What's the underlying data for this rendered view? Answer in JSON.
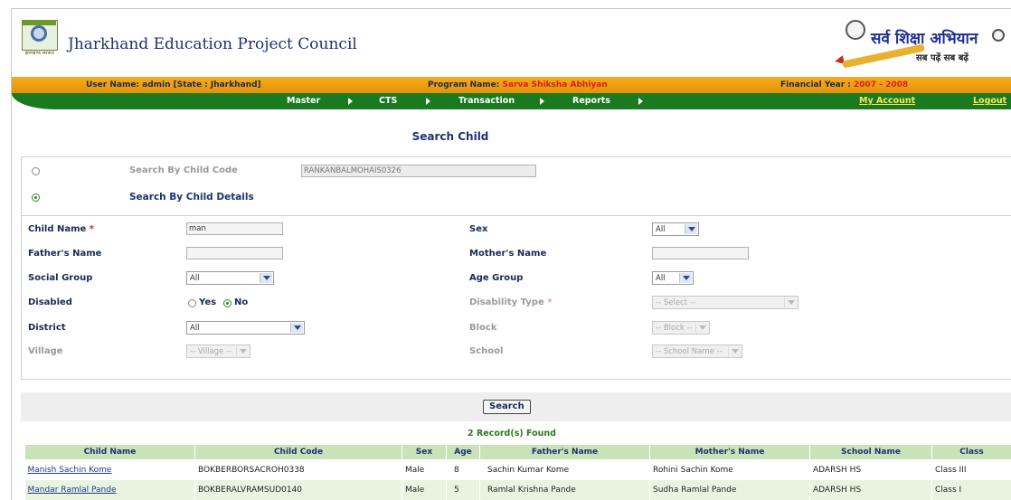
{
  "header": {
    "title": "Jharkhand Education Project Council",
    "logo_caption": "झारखण्ड सरकार",
    "ssa_logo_text": "सर्व शिक्षा अभियान",
    "ssa_logo_tagline": "सब पढ़ें सब बढ़ें"
  },
  "infobar": {
    "user_label": "User Name: admin [State : Jharkhand]",
    "program_label": "Program Name:",
    "program_value": "Sarva Shiksha Abhiyan",
    "fy_label": "Financial Year :",
    "fy_value": "2007 - 2008"
  },
  "nav": {
    "items": [
      "Master",
      "CTS",
      "Transaction",
      "Reports"
    ],
    "my_account": "My Account",
    "logout": "Logout"
  },
  "page": {
    "title": "Search Child"
  },
  "search_mode": {
    "by_code_label": "Search By Child Code",
    "by_code_value": "RANKANBALMOHAIS0326",
    "by_details_label": "Search By Child Details",
    "selected": "details"
  },
  "form": {
    "child_name_label": "Child Name",
    "required_mark": "*",
    "child_name_value": "man",
    "sex_label": "Sex",
    "sex_value": "All",
    "fathers_name_label": "Father's Name",
    "fathers_name_value": "",
    "mothers_name_label": "Mother's Name",
    "mothers_name_value": "",
    "social_group_label": "Social Group",
    "social_group_value": "All",
    "age_group_label": "Age Group",
    "age_group_value": "All",
    "disabled_label": "Disabled",
    "disabled_yes": "Yes",
    "disabled_no": "No",
    "disabled_selected": "No",
    "disability_type_label": "Disability Type",
    "disability_type_value": "-- Select --",
    "district_label": "District",
    "district_value": "All",
    "block_label": "Block",
    "block_value": "-- Block --",
    "village_label": "Village",
    "village_value": "-- Village --",
    "school_label": "School",
    "school_value": "-- School Name --"
  },
  "search_button": "Search",
  "results": {
    "count_text": "2 Record(s) Found",
    "columns": [
      "Child Name",
      "Child Code",
      "Sex",
      "Age",
      "Father's Name",
      "Mother's Name",
      "School Name",
      "Class"
    ],
    "rows": [
      [
        "Manish Sachin Kome",
        "BOKBERBORSACROH0338",
        "Male",
        "8",
        "Sachin Kumar Kome",
        "Rohini Sachin Kome",
        "ADARSH HS",
        "Class III"
      ],
      [
        "Mandar Ramlal Pande",
        "BOKBERALVRAMSUD0140",
        "Male",
        "5",
        "Ramlal Krishna Pande",
        "Sudha Ramlal Pande",
        "ADARSH HS",
        "Class I"
      ]
    ]
  }
}
